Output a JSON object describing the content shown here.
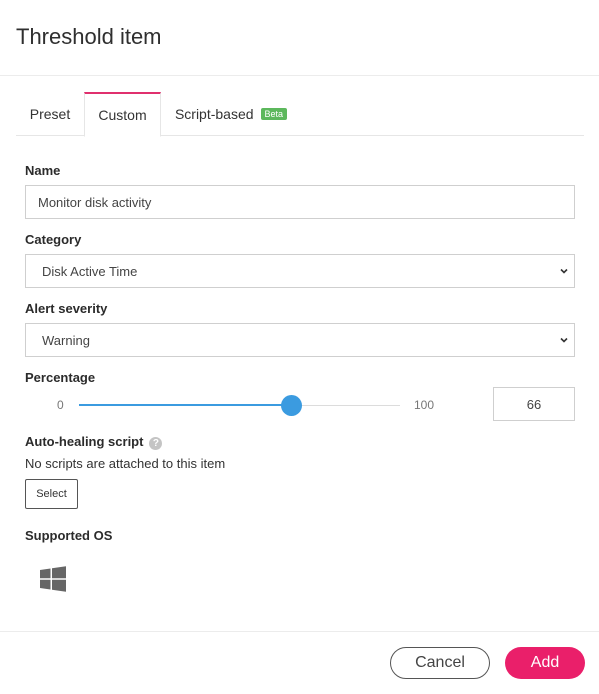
{
  "dialog": {
    "title": "Threshold item"
  },
  "tabs": [
    {
      "label": "Preset"
    },
    {
      "label": "Custom",
      "active": true
    },
    {
      "label": "Script-based",
      "badge": "Beta"
    }
  ],
  "form": {
    "name": {
      "label": "Name",
      "value": "Monitor disk activity"
    },
    "category": {
      "label": "Category",
      "value": "Disk Active Time"
    },
    "severity": {
      "label": "Alert severity",
      "value": "Warning"
    },
    "percentage": {
      "label": "Percentage",
      "min": "0",
      "max": "100",
      "value": "66",
      "fraction": 0.66
    },
    "auto_healing": {
      "label": "Auto-healing script",
      "help_icon": "question-circle-icon",
      "empty_text": "No scripts are attached to this item",
      "select_label": "Select"
    },
    "supported_os": {
      "label": "Supported OS",
      "icons": [
        "windows-icon"
      ]
    }
  },
  "footer": {
    "cancel_label": "Cancel",
    "add_label": "Add"
  },
  "colors": {
    "accent": "#ea1f6a",
    "tab_active_border": "#e0306e",
    "slider": "#3b9be0",
    "beta_badge": "#5cb85c"
  }
}
